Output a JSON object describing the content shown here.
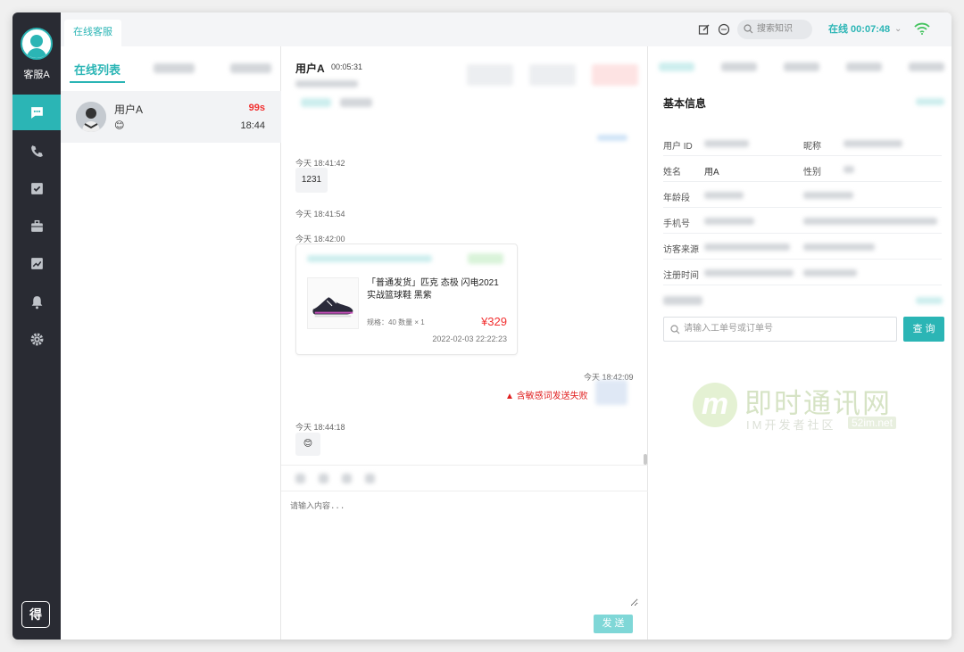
{
  "agent": {
    "name": "客服A"
  },
  "topbar": {
    "tab_label": "在线客服",
    "search_placeholder": "搜索知识",
    "status": "在线 00:07:48"
  },
  "sessions": {
    "tab_active": "在线列表",
    "items": [
      {
        "name": "用户A",
        "emoji": "😊",
        "timer": "99s",
        "time": "18:44"
      }
    ]
  },
  "chat": {
    "header": {
      "name": "用户A",
      "duration": "00:05:31"
    },
    "messages": [
      {
        "time": "今天 18:41:42",
        "text": "1231"
      },
      {
        "time": "今天 18:41:54"
      },
      {
        "time": "今天 18:42:00"
      },
      {
        "time": "今天 18:42:09",
        "error": "含敏感词发送失败"
      },
      {
        "time": "今天 18:44:18",
        "text": "😊"
      }
    ],
    "order_card": {
      "title": "「普通发货」匹克 态极 闪电2021 实战篮球鞋 黑紫",
      "spec": "规格：40  数量 × 1",
      "price": "¥329",
      "date": "2022-02-03 22:22:23"
    },
    "input_placeholder": "请输入内容...",
    "send_label": "发 送"
  },
  "info": {
    "section_title": "基本信息",
    "fields": {
      "user_id": "用户 ID",
      "nickname": "昵称",
      "name": "姓名",
      "name_value": "用A",
      "gender": "性别",
      "age": "年龄段",
      "phone": "手机号",
      "source": "访客来源",
      "register": "注册时间"
    },
    "order_placeholder": "请输入工单号或订单号",
    "query_label": "查 询"
  },
  "watermark": {
    "cn": "即时通讯网",
    "sub": "IM开发者社区",
    "site": "52im.net"
  },
  "colors": {
    "accent": "#2bb5b5",
    "rail": "#292b33",
    "error": "#e02020"
  }
}
